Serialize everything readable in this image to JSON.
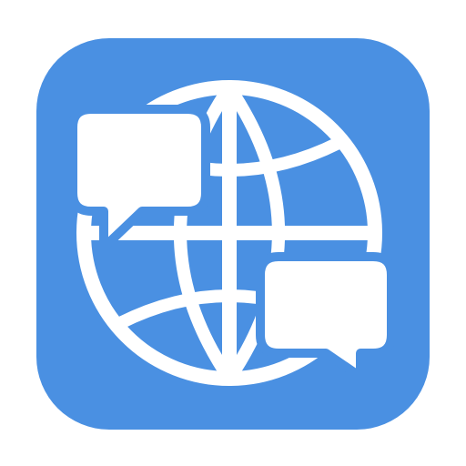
{
  "app_icon": {
    "icon": "globe-chat-icon",
    "background_color": "#4A90E2",
    "glyph_color": "#FFFFFF",
    "elements": {
      "globe": "globe-icon",
      "top_left_bubble": "speech-bubble-icon",
      "bottom_right_bubble": "speech-bubble-icon"
    }
  }
}
